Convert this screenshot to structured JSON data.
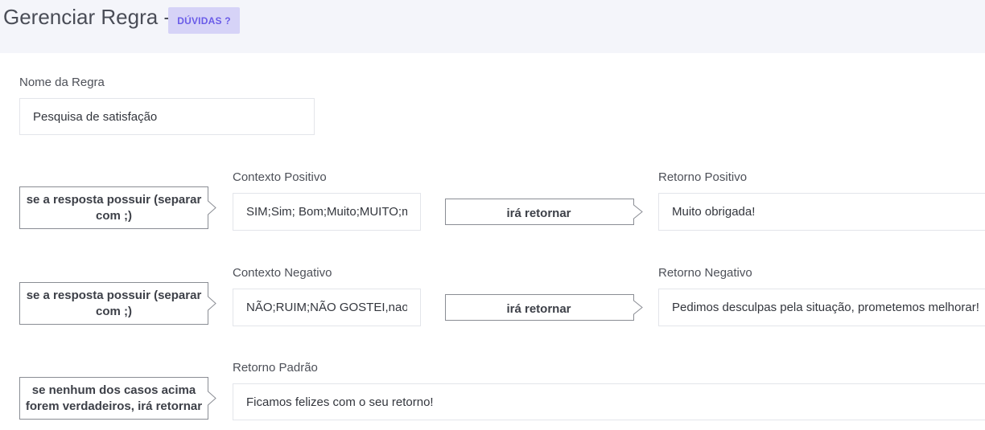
{
  "header": {
    "title": "Gerenciar Regra -",
    "help_badge": "DÚVIDAS ?"
  },
  "rule_name": {
    "label": "Nome da Regra",
    "value": "Pesquisa de satisfação"
  },
  "positive": {
    "condition": "se a resposta possuir (separar com ;)",
    "context_label": "Contexto Positivo",
    "context_value": "SIM;Sim; Bom;Muito;MUITO;m",
    "arrow_label": "irá retornar",
    "return_label": "Retorno Positivo",
    "return_value": "Muito obrigada!"
  },
  "negative": {
    "condition": "se a resposta possuir (separar com ;)",
    "context_label": "Contexto Negativo",
    "context_value": "NÃO;RUIM;NÃO GOSTEI,nao;nã",
    "arrow_label": "irá retornar",
    "return_label": "Retorno Negativo",
    "return_value": "Pedimos desculpas pela situação, prometemos melhorar!"
  },
  "default": {
    "condition": "se nenhum dos casos acima forem verdadeiros, irá retornar",
    "return_label": "Retorno Padrão",
    "return_value": "Ficamos felizes com o seu retorno!"
  }
}
